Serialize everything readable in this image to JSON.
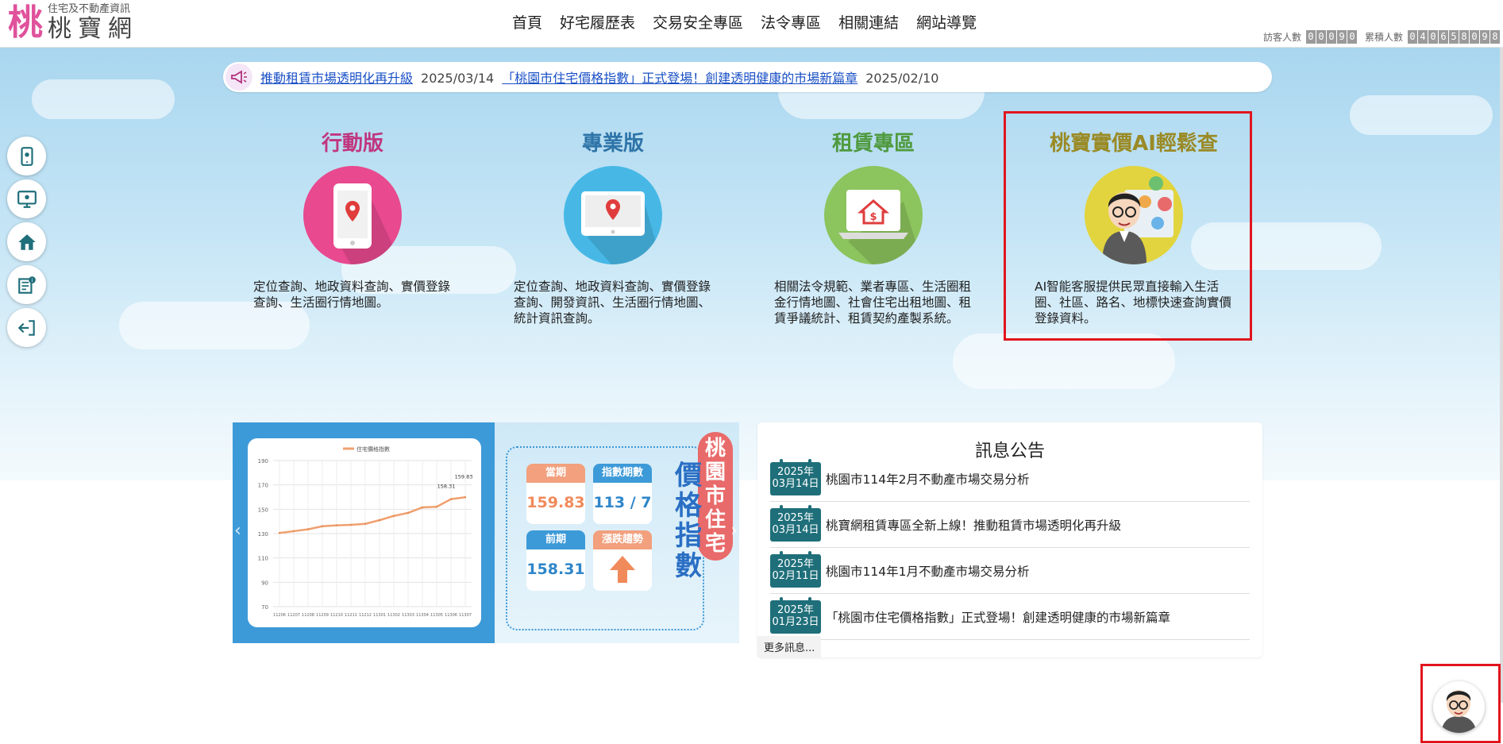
{
  "header": {
    "logo_mark": "桃",
    "logo_sub": "住宅及不動產資訊",
    "logo_main": "桃寶網",
    "nav": [
      "首頁",
      "好宅履歷表",
      "交易安全專區",
      "法令專區",
      "相關連結",
      "網站導覽"
    ],
    "visitor_label": "訪客人數",
    "visitor_digits": [
      "0",
      "0",
      "0",
      "9",
      "0"
    ],
    "total_label": "累積人數",
    "total_digits": [
      "0",
      "4",
      "0",
      "6",
      "5",
      "8",
      "0",
      "9",
      "8"
    ]
  },
  "marquee": {
    "items": [
      {
        "title": "推動租賃市場透明化再升級",
        "date": "2025/03/14"
      },
      {
        "title": "「桃園市住宅價格指數」正式登場！創建透明健康的市場新篇章",
        "date": "2025/02/10"
      }
    ]
  },
  "features": [
    {
      "title": "行動版",
      "color": "#c0367e",
      "circle": "#e8498f",
      "desc": "定位查詢、地政資料查詢、實價登錄查詢、生活圈行情地圖。"
    },
    {
      "title": "專業版",
      "color": "#2e74a8",
      "circle": "#47b8e6",
      "desc": "定位查詢、地政資料查詢、實價登錄查詢、開發資訊、生活圈行情地圖、統計資訊查詢。"
    },
    {
      "title": "租賃專區",
      "color": "#4f9a3e",
      "circle": "#8cc45e",
      "desc": "相關法令規範、業者專區、生活圈租金行情地圖、社會住宅出租地圖、租賃爭議統計、租賃契約產製系統。"
    },
    {
      "title": "桃寶實價AI輕鬆查",
      "color": "#9a8a25",
      "circle": "#e2d43e",
      "desc": "AI智能客服提供民眾直接輸入生活圈、社區、路名、地標快速查詢實價登錄資料。"
    }
  ],
  "banner": {
    "legend": "住宅價格指數",
    "y_ticks": [
      "190",
      "170",
      "150",
      "130",
      "110",
      "90",
      "70"
    ],
    "x_ticks": [
      "11206",
      "11207",
      "11208",
      "11209",
      "11210",
      "11211",
      "11212",
      "11301",
      "11302",
      "11303",
      "11304",
      "11305",
      "11306",
      "11307"
    ],
    "series_values": [
      130.5,
      132.0,
      133.5,
      136.0,
      136.8,
      137.2,
      138.0,
      141.0,
      144.5,
      147.0,
      151.5,
      152.0,
      158.31,
      159.83
    ],
    "label_prev": "158.31",
    "label_curr": "159.83",
    "tile_current_label": "當期",
    "tile_current_value": "159.83",
    "tile_period_label": "指數期數",
    "tile_period_value": "113 / 7",
    "tile_prev_label": "前期",
    "tile_prev_value": "158.31",
    "tile_trend_label": "漲跌趨勢",
    "vertical_title_1": "桃園市住宅",
    "vertical_title_2": "價格指數"
  },
  "announcements": {
    "title": "訊息公告",
    "items": [
      {
        "year": "2025年",
        "day": "03月14日",
        "title": "桃園市114年2月不動產市場交易分析"
      },
      {
        "year": "2025年",
        "day": "03月14日",
        "title": "桃寶網租賃專區全新上線！推動租賃市場透明化再升級"
      },
      {
        "year": "2025年",
        "day": "02月11日",
        "title": "桃園市114年1月不動產市場交易分析"
      },
      {
        "year": "2025年",
        "day": "01月23日",
        "title": "「桃園市住宅價格指數」正式登場！創建透明健康的市場新篇章"
      }
    ],
    "more": "更多訊息..."
  },
  "sidebar_icons": [
    "mobile-map-icon",
    "desktop-map-icon",
    "home-icon",
    "news-icon",
    "exit-icon"
  ]
}
